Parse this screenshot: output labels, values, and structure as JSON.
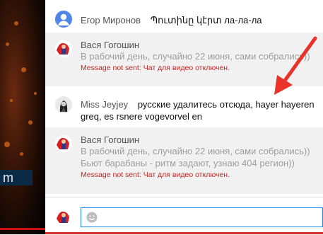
{
  "video": {
    "logo_text": "m"
  },
  "messages": [
    {
      "author": "Егор Миронов",
      "text": "Պուտինը կէրտ ла-ла-ла",
      "avatar": "default-user-avatar"
    },
    {
      "author": "Вася Гогошин",
      "text": "В рабочий день, случайно 22 июня, сами собрались))",
      "error": "Message not sent: Чат для видео отключен.",
      "avatar": "vasya-avatar"
    },
    {
      "author": "Miss Jeyjey",
      "text": "русские удалитесь отсюда, hayer hayeren greq, es rsnere vogevorvel en",
      "avatar": "miss-jeyjey-avatar"
    },
    {
      "author": "Вася Гогошин",
      "text": "В рабочий день, случайно 22 июня, сами собрались)) Бьют барабаны - ритм задают, узнаю 404 регион))",
      "error": "Message not sent: Чат для видео отключен.",
      "avatar": "vasya-avatar"
    }
  ],
  "input": {
    "placeholder": "",
    "emoji_icon": "emoji-icon"
  },
  "colors": {
    "arrow": "#e8322a",
    "error": "#c62828",
    "input_border": "#1e88e5"
  }
}
